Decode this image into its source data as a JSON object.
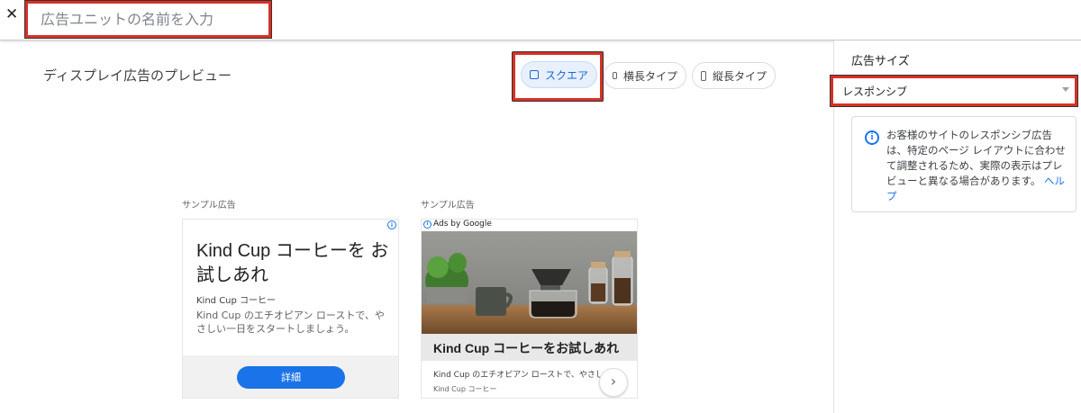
{
  "header": {
    "close_glyph": "✕",
    "name_placeholder": "広告ユニットの名前を入力"
  },
  "preview": {
    "title": "ディスプレイ広告のプレビュー",
    "shapes": [
      {
        "label": "スクエア",
        "selected": true
      },
      {
        "label": "横長タイプ",
        "selected": false
      },
      {
        "label": "縦長タイプ",
        "selected": false
      }
    ]
  },
  "side": {
    "size_label": "広告サイズ",
    "size_value": "レスポンシブ",
    "info_text": "お客様のサイトのレスポンシブ広告は、特定のページ レイアウトに合わせて調整されるため、実際の表示はプレビューと異なる場合があります。",
    "help_link": "ヘルプ"
  },
  "ads": {
    "sample_label": "サンプル広告",
    "ad1": {
      "headline": "Kind Cup コーヒーを お試しあれ",
      "brand": "Kind Cup コーヒー",
      "description": "Kind Cup のエチオピアン ローストで、やさしい一日をスタートしましょう。",
      "cta": "詳細",
      "adchoice": "i"
    },
    "ad2": {
      "ads_by": "Ads by Google",
      "headline": "Kind Cup コーヒーをお試しあれ",
      "description": "Kind Cup のエチオピアン ローストで、やさし...",
      "brand": "Kind Cup コーヒー",
      "arrow": "›"
    }
  },
  "colors": {
    "accent": "#1a73e8",
    "highlight": "#d93025",
    "selected_chip": "#e8f0fe"
  }
}
